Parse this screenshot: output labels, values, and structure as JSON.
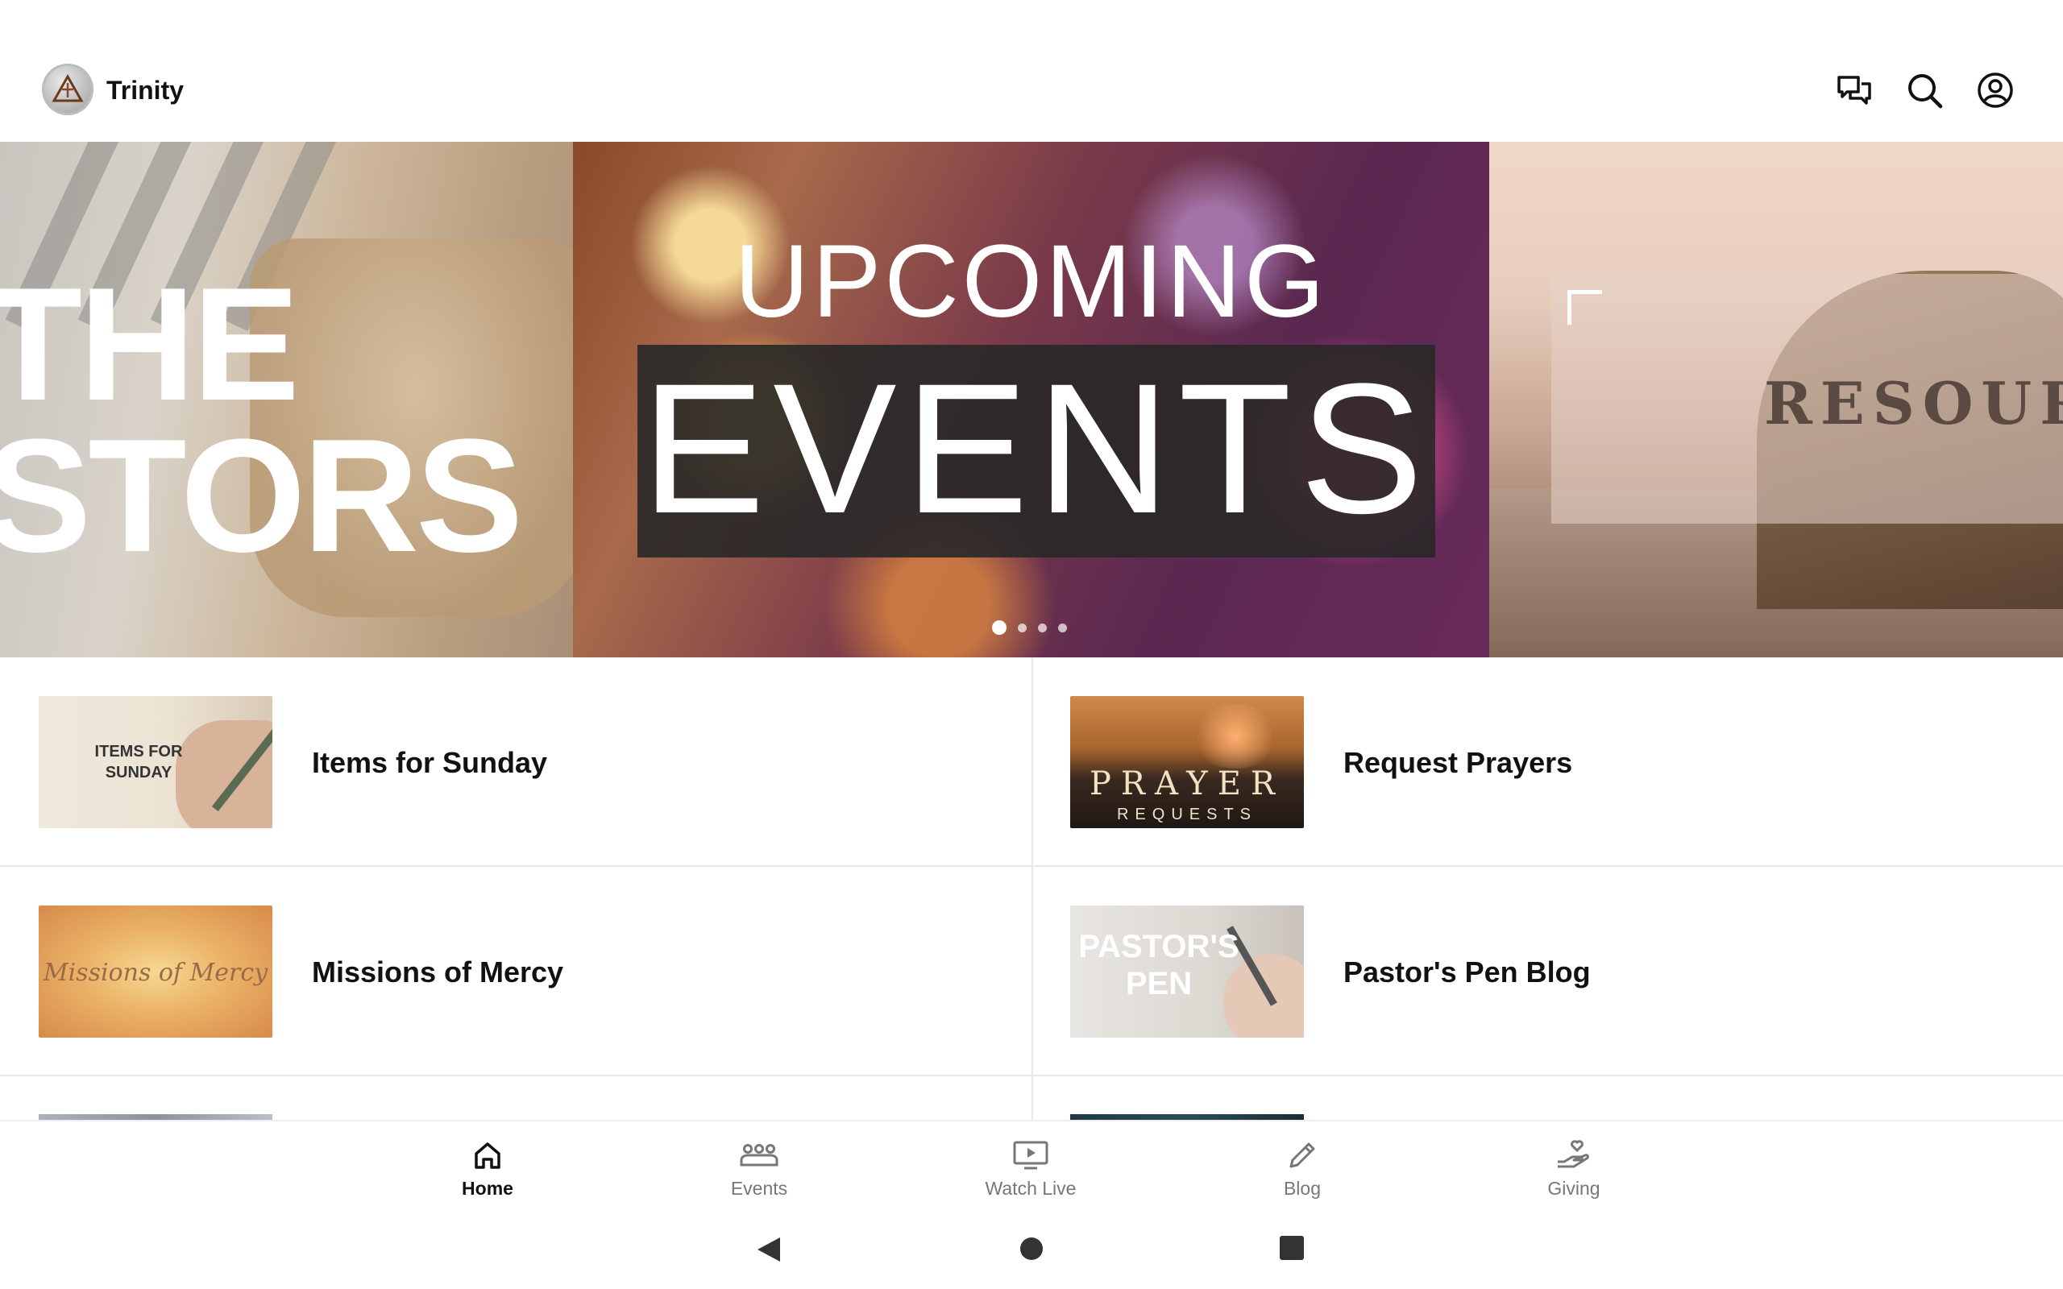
{
  "header": {
    "app_title": "Trinity",
    "icons": [
      "chat-icon",
      "search-icon",
      "account-icon"
    ]
  },
  "carousel": {
    "slides": [
      {
        "lines": [
          "THE",
          "STORS"
        ]
      },
      {
        "line1": "UPCOMING",
        "line2": "EVENTS"
      },
      {
        "text": "RESOURC"
      }
    ],
    "dot_count": 4,
    "active_dot": 0
  },
  "list": {
    "items": [
      {
        "label": "Items for Sunday",
        "thumb_text": "ITEMS FOR SUNDAY"
      },
      {
        "label": "Request Prayers",
        "thumb_line1": "PRAYER",
        "thumb_line2": "REQUESTS"
      },
      {
        "label": "Missions of Mercy",
        "thumb_text": "Missions of Mercy"
      },
      {
        "label": "Pastor's Pen Blog",
        "thumb_text": "PASTOR'S PEN"
      }
    ]
  },
  "bottom_nav": {
    "items": [
      {
        "label": "Home",
        "icon": "home-icon",
        "active": true
      },
      {
        "label": "Events",
        "icon": "people-group-icon",
        "active": false
      },
      {
        "label": "Watch Live",
        "icon": "tv-play-icon",
        "active": false
      },
      {
        "label": "Blog",
        "icon": "pencil-icon",
        "active": false
      },
      {
        "label": "Giving",
        "icon": "hand-heart-icon",
        "active": false
      }
    ]
  },
  "system_bar": {
    "icons": [
      "back-icon",
      "home-circle-icon",
      "recents-icon"
    ]
  },
  "colors": {
    "text_primary": "#111111",
    "text_muted": "#777777",
    "divider": "#e8e8e8"
  }
}
